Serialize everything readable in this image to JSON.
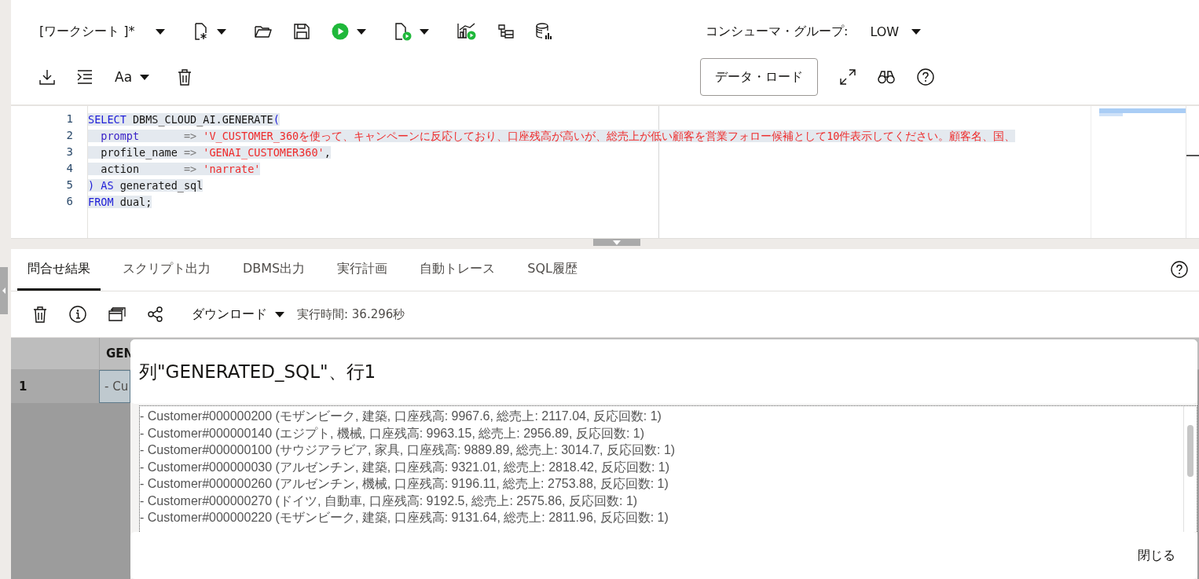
{
  "toolbar": {
    "worksheet_title": "[ワークシート ]*",
    "consumer_group_label": "コンシューマ・グループ:",
    "consumer_group_value": "LOW",
    "data_load_button": "データ・ロード",
    "font_button": "Aa"
  },
  "editor": {
    "lines": [
      {
        "number": "1",
        "tokens": [
          {
            "kind": "keyword",
            "text": "SELECT"
          },
          {
            "kind": "plain",
            "text": " DBMS_CLOUD_AI.GENERATE"
          },
          {
            "kind": "keyword",
            "text": "("
          }
        ]
      },
      {
        "number": "2",
        "tokens": [
          {
            "kind": "param",
            "text": "  prompt"
          },
          {
            "kind": "op",
            "text": "       => "
          },
          {
            "kind": "string",
            "text": "'V_CUSTOMER_360を使って、キャンペーンに反応しており、口座残高が高いが、総売上が低い顧客を営業フォロー候補として10件表示してください。顧客名、国、"
          }
        ]
      },
      {
        "number": "3",
        "tokens": [
          {
            "kind": "plain",
            "text": "  profile_name "
          },
          {
            "kind": "op",
            "text": "=> "
          },
          {
            "kind": "string",
            "text": "'GENAI_CUSTOMER360'"
          },
          {
            "kind": "plain",
            "text": ","
          }
        ]
      },
      {
        "number": "4",
        "tokens": [
          {
            "kind": "plain",
            "text": "  action       "
          },
          {
            "kind": "op",
            "text": "=> "
          },
          {
            "kind": "string",
            "text": "'narrate'"
          }
        ]
      },
      {
        "number": "5",
        "tokens": [
          {
            "kind": "keyword",
            "text": ") AS"
          },
          {
            "kind": "plain",
            "text": " generated_sql"
          }
        ]
      },
      {
        "number": "6",
        "tokens": [
          {
            "kind": "keyword",
            "text": "FROM"
          },
          {
            "kind": "plain",
            "text": " dual;"
          }
        ]
      }
    ]
  },
  "results": {
    "tabs": [
      {
        "label": "問合せ結果",
        "selected": true
      },
      {
        "label": "スクリプト出力",
        "selected": false
      },
      {
        "label": "DBMS出力",
        "selected": false
      },
      {
        "label": "実行計画",
        "selected": false
      },
      {
        "label": "自動トレース",
        "selected": false
      },
      {
        "label": "SQL履歴",
        "selected": false
      }
    ],
    "download_label": "ダウンロード",
    "execution_time": "実行時間: 36.296秒",
    "grid": {
      "column_1_header": "GEN",
      "rows": [
        {
          "row_number": "1",
          "cell": "- Cu",
          "selected": true
        }
      ]
    }
  },
  "dialog": {
    "title": "列\"GENERATED_SQL\"、行1",
    "lines": [
      "- Customer#000000200 (モザンビーク, 建築, 口座残高: 9967.6, 総売上: 2117.04, 反応回数: 1)",
      "- Customer#000000140 (エジプト, 機械, 口座残高: 9963.15, 総売上: 2956.89, 反応回数: 1)",
      "- Customer#000000100 (サウジアラビア, 家具, 口座残高: 9889.89, 総売上: 3014.7, 反応回数: 1)",
      "- Customer#000000030 (アルゼンチン, 建築, 口座残高: 9321.01, 総売上: 2818.42, 反応回数: 1)",
      "- Customer#000000260 (アルゼンチン, 機械, 口座残高: 9196.11, 総売上: 2753.88, 反応回数: 1)",
      "- Customer#000000270 (ドイツ, 自動車, 口座残高: 9192.5, 総売上: 2575.86, 反応回数: 1)",
      "- Customer#000000220 (モザンビーク, 建築, 口座残高: 9131.64, 総売上: 2811.96, 反応回数: 1)"
    ],
    "close_button": "閉じる"
  }
}
